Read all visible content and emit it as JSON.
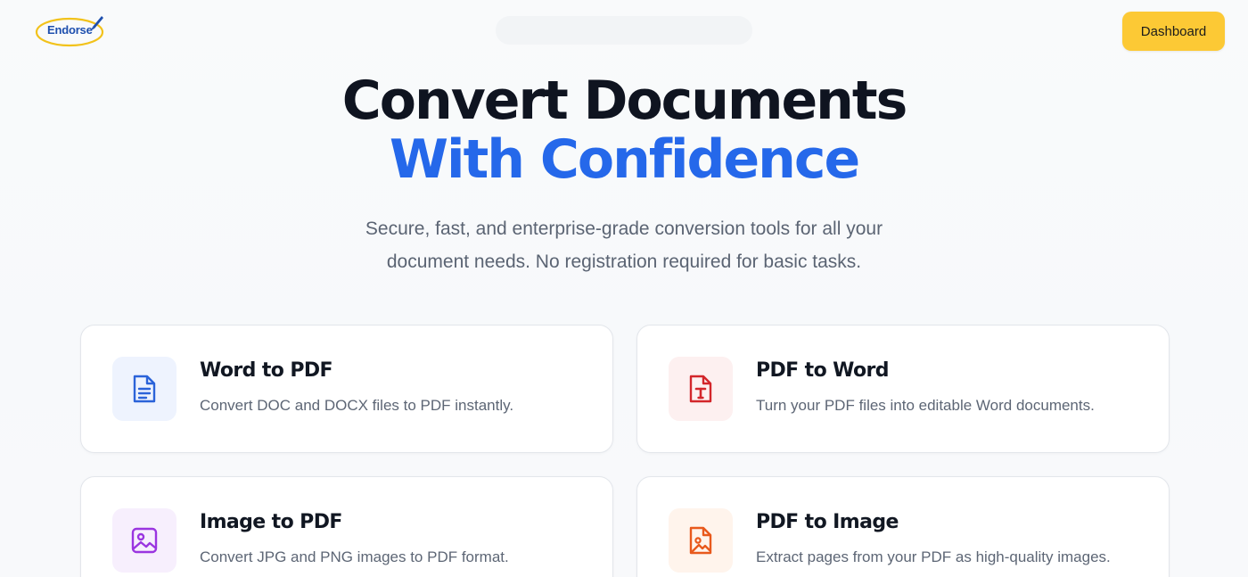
{
  "header": {
    "logo_text": "Endorse",
    "dashboard_label": "Dashboard"
  },
  "hero": {
    "title_line1": "Convert Documents",
    "title_line2": "With Confidence",
    "subtitle_line1": "Secure, fast, and enterprise-grade conversion tools for all your",
    "subtitle_line2": "document needs. No registration required for basic tasks."
  },
  "tools": [
    {
      "title": "Word to PDF",
      "description": "Convert DOC and DOCX files to PDF instantly.",
      "icon": "document-text-icon",
      "accent": "#2b63d9",
      "tint": "#eef3fe"
    },
    {
      "title": "PDF to Word",
      "description": "Turn your PDF files into editable Word documents.",
      "icon": "file-type-icon",
      "accent": "#d3262b",
      "tint": "#fdf0f0"
    },
    {
      "title": "Image to PDF",
      "description": "Convert JPG and PNG images to PDF format.",
      "icon": "image-icon",
      "accent": "#9a35e0",
      "tint": "#f7effd"
    },
    {
      "title": "PDF to Image",
      "description": "Extract pages from your PDF as high-quality images.",
      "icon": "file-image-icon",
      "accent": "#e8591c",
      "tint": "#fff4ec"
    }
  ],
  "colors": {
    "brand_blue": "#2568ea",
    "button_yellow": "#fcc935",
    "logo_ring": "#f2c21b"
  }
}
